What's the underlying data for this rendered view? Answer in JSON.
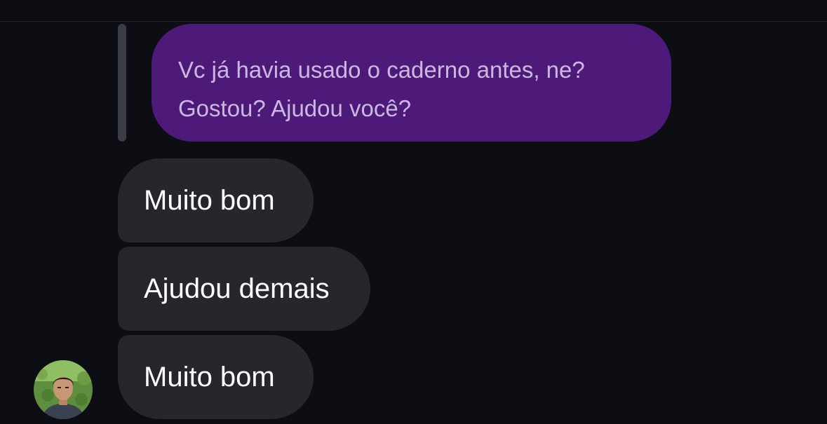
{
  "replied_message": {
    "text": "Vc já havia usado o caderno antes, ne?\nGostou? Ajudou você?"
  },
  "messages": [
    {
      "text": "Muito bom"
    },
    {
      "text": "Ajudou demais"
    },
    {
      "text": "Muito bom"
    }
  ],
  "colors": {
    "background": "#0c0e14",
    "sent_bubble": "#4d1a7a",
    "received_bubble": "#25272d",
    "reply_indicator": "#3a3d45"
  },
  "avatar": {
    "icon": "user-avatar-photo"
  }
}
